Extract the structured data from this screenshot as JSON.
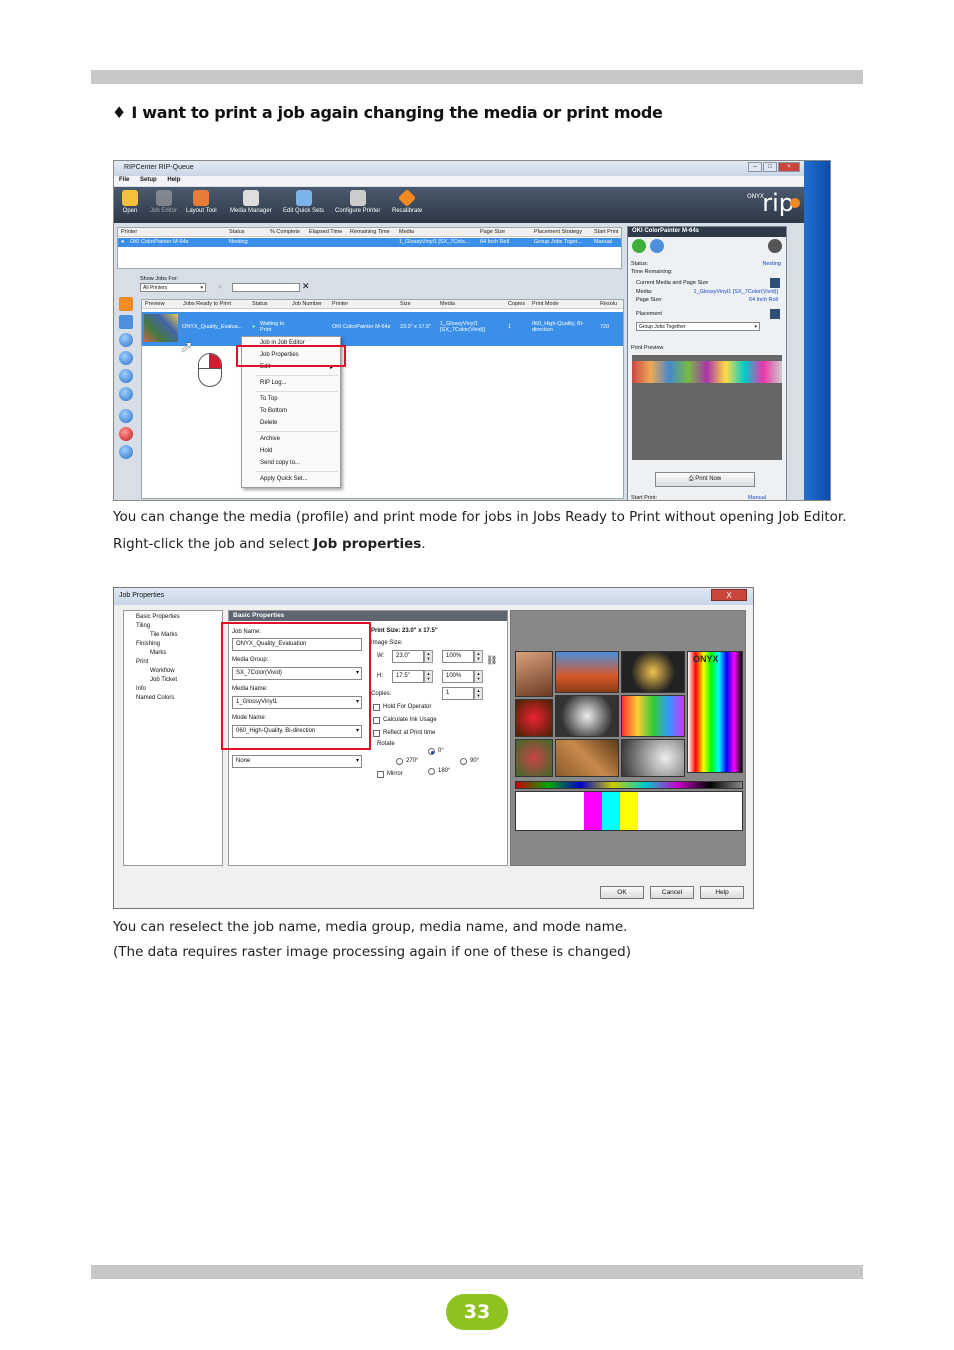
{
  "heading": "I want to print a job again changing the media or print mode",
  "heading_bullet": "♦",
  "para1": "You can change the media (profile) and print mode for jobs in Jobs Ready to Print without opening Job Editor.",
  "para2_pre": "Right-click the job and select ",
  "para2_bold": "Job properties",
  "para2_post": ".",
  "para3": "You can reselect the job name, media group, media name, and mode name.",
  "para4": "(The data requires raster image processing again if one of these is changed)",
  "page_number": "33",
  "colors": {
    "accent_green": "#8dc21f",
    "highlight_red": "#e0102a",
    "selection_blue": "#3b8fe8"
  },
  "ss1": {
    "title": "RIPCenter RIP-Queue",
    "menu": [
      "File",
      "Setup",
      "Help"
    ],
    "toolbar": [
      "Open",
      "Job Editor",
      "Layout Tool",
      "Media Manager",
      "Edit Quick Sets",
      "Configure Printer",
      "Recalibrate"
    ],
    "logo_small": "ONYX",
    "logo": "rip",
    "printer_cols": [
      "Printer",
      "Status",
      "% Complete",
      "Elapsed Time",
      "Remaining Time",
      "Media",
      "Page Size",
      "Placement Strategy",
      "Start Print"
    ],
    "printer_row": {
      "printer": "OKI ColorPainter M-64s",
      "status": "Nesting",
      "media": "1_GlossyVinyl1 [SX_7Colo...",
      "page_size": "64 Inch Roll",
      "placement": "Group Jobs Toget...",
      "start": "Manual"
    },
    "show_jobs_label": "Show Jobs For:",
    "show_jobs_value": "All Printers",
    "job_cols": [
      "Preview",
      "Jobs Ready to Print",
      "Status",
      "Job Number",
      "Printer",
      "Size",
      "Media",
      "Copies",
      "Print Mode",
      "Resolu"
    ],
    "job_row": {
      "name": "ONYX_Quality_Evalua...",
      "status": "Waiting to Print",
      "printer": "OKI ColorPainter M-64s",
      "size": "23.0\" x 17.5\"",
      "media": "1_GlossyVinyl1 [SX_7Color(Vivid)]",
      "copies": "1",
      "mode": "060_High-Quality, Bi-direction",
      "res": "720"
    },
    "context_menu": [
      "Job in Job Editor",
      "Job Properties",
      "Edit",
      "RIP Log...",
      "To Top",
      "To Bottom",
      "Delete",
      "Archive",
      "Hold",
      "Send copy to...",
      "Apply Quick Set..."
    ],
    "panel": {
      "title": "OKI ColorPainter M-64s",
      "status_label": "Status:",
      "status": "Nesting",
      "time_label": "Time Remaining:",
      "current_media_label": "Current Media and Page Size",
      "media_label": "Media:",
      "media": "1_GlossyVinyl1 [SX_7Color(Vivid)]",
      "page_size_label": "Page Size:",
      "page_size": "64 Inch Roll",
      "placement_label": "Placement",
      "placement": "Group Jobs Together",
      "preview_label": "Print Preview",
      "print_now": "Print Now",
      "start_label": "Start Print:",
      "start": "Manual"
    }
  },
  "ss2": {
    "title": "Job Properties",
    "close": "X",
    "tree": [
      "Basic Properties",
      "Tiling",
      "Tile Marks",
      "Finishing",
      "Marks",
      "Print",
      "Workflow",
      "Job Ticket",
      "Info",
      "Named Colors"
    ],
    "header": "Basic Properties",
    "job_name_label": "Job Name:",
    "job_name": "ONYX_Quality_Evaluation",
    "media_group_label": "Media Group:",
    "media_group": "SX_7Color(Vivid)",
    "media_name_label": "Media Name:",
    "media_name": "1_GlossyVinyl1",
    "mode_name_label": "Mode Name:",
    "mode_name": "060_High-Quality, Bi-direction",
    "extra_value": "None",
    "print_size": "Print Size: 23.0\" x 17.5\"",
    "image_size_label": "Image Size:",
    "w_label": "W:",
    "w": "23.0\"",
    "w_pct": "100%",
    "h_label": "H:",
    "h": "17.5\"",
    "h_pct": "100%",
    "copies_label": "Copies:",
    "copies": "1",
    "hold": "Hold For Operator",
    "calc_ink": "Calculate Ink Usage",
    "reflect": "Reflect at Print time",
    "rotate_label": "Rotate",
    "rot_0": "0°",
    "rot_90": "90°",
    "rot_270": "270°",
    "rot_180": "180°",
    "mirror": "Mirror",
    "preview_logo": "ONYX",
    "buttons": [
      "OK",
      "Cancel",
      "Help"
    ]
  }
}
